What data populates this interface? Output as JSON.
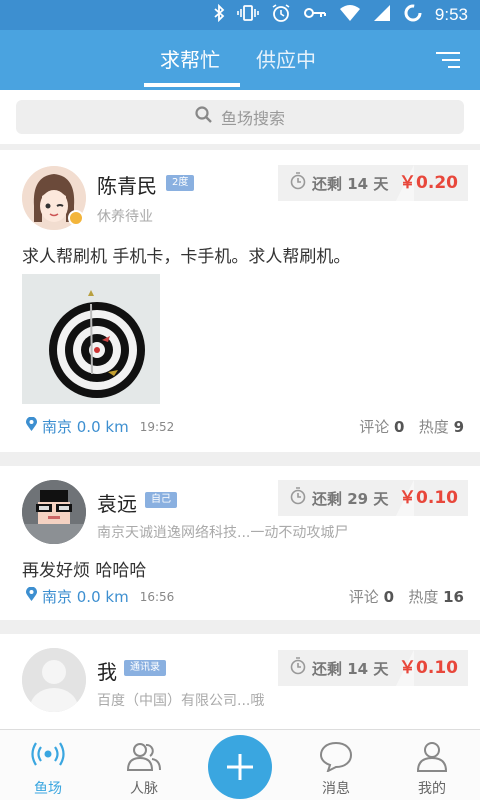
{
  "status_bar": {
    "time": "9:53"
  },
  "header": {
    "tabs": [
      {
        "label": "求帮忙",
        "active": true
      },
      {
        "label": "供应中",
        "active": false
      }
    ]
  },
  "search": {
    "placeholder": "鱼场搜索"
  },
  "posts": [
    {
      "name": "陈青民",
      "badge": "2度",
      "subtitle": "休养待业",
      "remaining": "还剩 14 天",
      "price": "￥0.20",
      "content": "求人帮刷机 手机卡，卡手机。求人帮刷机。",
      "location": "南京 0.0 km",
      "time": "19:52",
      "comments_label": "评论",
      "comments": "0",
      "heat_label": "热度",
      "heat": "9"
    },
    {
      "name": "袁远",
      "badge": "自己",
      "subtitle": "南京天诚逍逸网络科技...一动不动攻城尸",
      "remaining": "还剩 29 天",
      "price": "￥0.10",
      "content": "再发好烦 哈哈哈",
      "location": "南京 0.0 km",
      "time": "16:56",
      "comments_label": "评论",
      "comments": "0",
      "heat_label": "热度",
      "heat": "16"
    },
    {
      "name": "我",
      "badge": "通讯录",
      "subtitle": "百度（中国）有限公司...哦",
      "remaining": "还剩 14 天",
      "price": "￥0.10"
    }
  ],
  "bottom_nav": {
    "items": [
      {
        "label": "鱼场",
        "icon": "broadcast-icon",
        "active": true
      },
      {
        "label": "人脉",
        "icon": "contacts-icon",
        "active": false
      },
      {
        "label": "消息",
        "icon": "chat-bubble-icon",
        "active": false
      },
      {
        "label": "我的",
        "icon": "person-icon",
        "active": false
      }
    ],
    "fab_icon": "plus-icon"
  },
  "colors": {
    "header": "#4aa3e0",
    "status_bar": "#3d8fd0",
    "price": "#e8473b",
    "accent": "#3aa6e0",
    "badge": "#8ab0e0"
  }
}
